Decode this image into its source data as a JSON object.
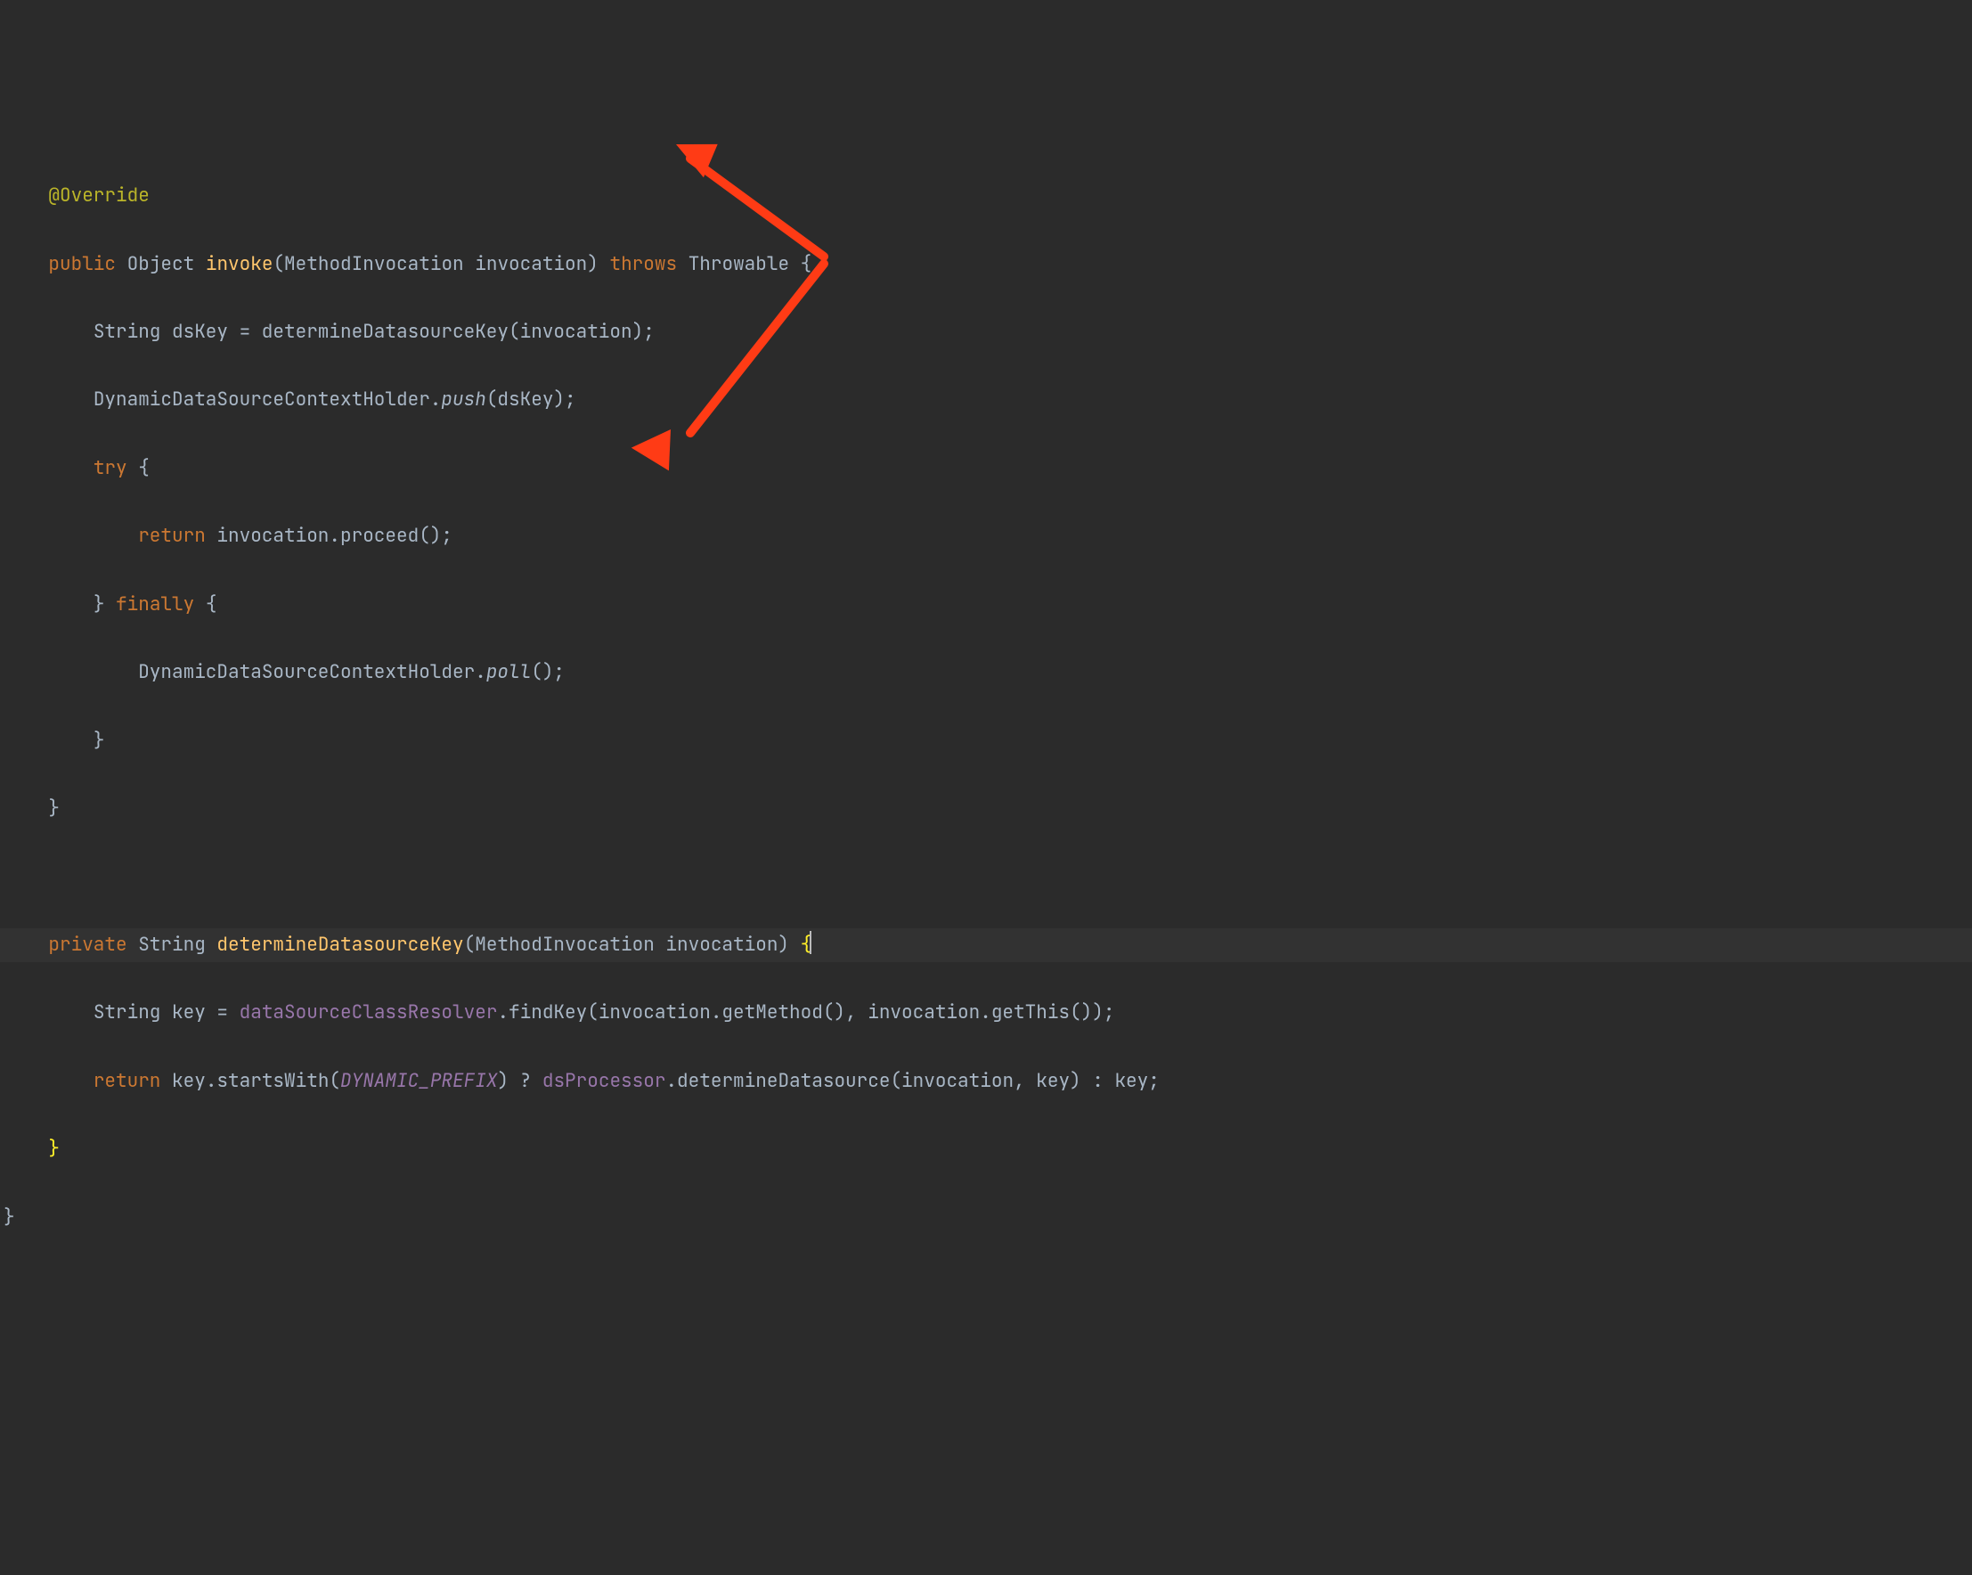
{
  "code": {
    "l1": {
      "annotation": "@Override"
    },
    "l2": {
      "kw1": "public",
      "type": "Object",
      "method": "invoke",
      "sig": "(MethodInvocation invocation)",
      "kw2": "throws",
      "tail": "Throwable {"
    },
    "l3": {
      "text": "String dsKey = determineDatasourceKey(invocation);"
    },
    "l4": {
      "head": "DynamicDataSourceContextHolder.",
      "push": "push",
      "tail": "(dsKey);"
    },
    "l5": {
      "kw": "try",
      "tail": " {"
    },
    "l6": {
      "kw": "return",
      "tail": " invocation.proceed();"
    },
    "l7": {
      "head": "} ",
      "kw": "finally",
      "tail": " {"
    },
    "l8": {
      "head": "DynamicDataSourceContextHolder.",
      "poll": "poll",
      "tail": "();"
    },
    "l9": {
      "text": "}"
    },
    "l10": {
      "text": "}"
    },
    "l11": {
      "kw": "private",
      "type": " String ",
      "method": "determineDatasourceKey",
      "sig": "(MethodInvocation invocation) ",
      "brace": "{"
    },
    "l12": {
      "head": "String key = ",
      "field": "dataSourceClassResolver",
      "tail": ".findKey(invocation.getMethod(), invocation.getThis());"
    },
    "l13": {
      "kw": "return",
      "mid1": " key.startsWith(",
      "const": "DYNAMIC_PREFIX",
      "mid2": ") ? ",
      "field": "dsProcessor",
      "tail": ".determineDatasource(invocation, key) : key;"
    },
    "l14": {
      "brace": "}"
    },
    "l15": {
      "text": "}"
    }
  }
}
